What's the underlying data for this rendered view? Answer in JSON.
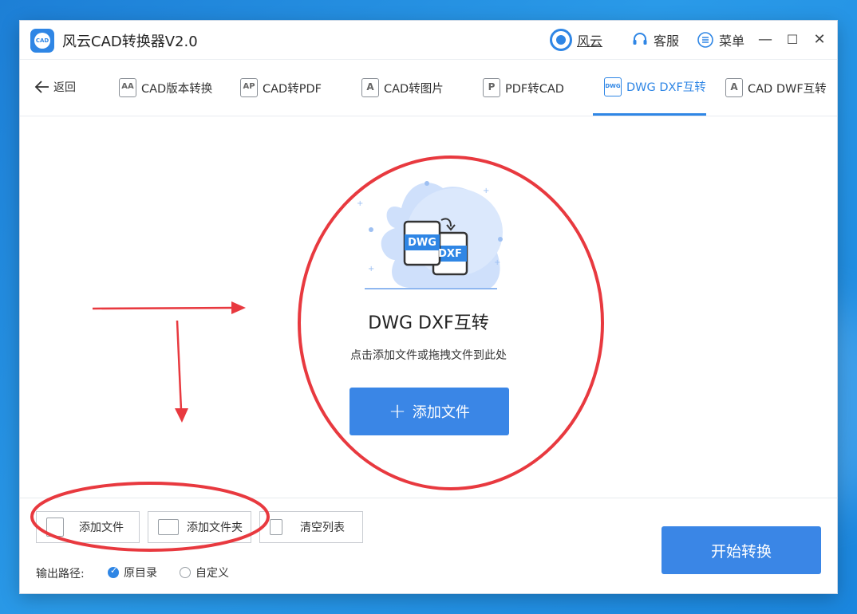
{
  "window": {
    "title": "风云CAD转换器V2.0",
    "fengyun_label": "风云",
    "support_label": "客服",
    "menu_label": "菜单",
    "minimize": "—",
    "maximize": "☐",
    "close": "✕"
  },
  "nav": {
    "back_label": "返回",
    "tabs": [
      {
        "label": "CAD版本转换",
        "icon": "AA"
      },
      {
        "label": "CAD转PDF",
        "icon": "AP"
      },
      {
        "label": "CAD转图片",
        "icon": "A"
      },
      {
        "label": "PDF转CAD",
        "icon": "P"
      },
      {
        "label": "DWG DXF互转",
        "icon": "DWG",
        "active": true
      },
      {
        "label": "CAD DWF互转",
        "icon": "A"
      }
    ]
  },
  "dropzone": {
    "icon_front": "DWG",
    "icon_back": "DXF",
    "title": "DWG DXF互转",
    "hint": "点击添加文件或拖拽文件到此处",
    "add_button": "添加文件",
    "add_plus": "+"
  },
  "bottom": {
    "add_file": "添加文件",
    "add_folder": "添加文件夹",
    "clear_list": "清空列表",
    "output_label": "输出路径:",
    "option_original": "原目录",
    "option_custom": "自定义",
    "start_button": "开始转换"
  },
  "colors": {
    "accent": "#3a86e6",
    "annotation": "#e8393f"
  }
}
